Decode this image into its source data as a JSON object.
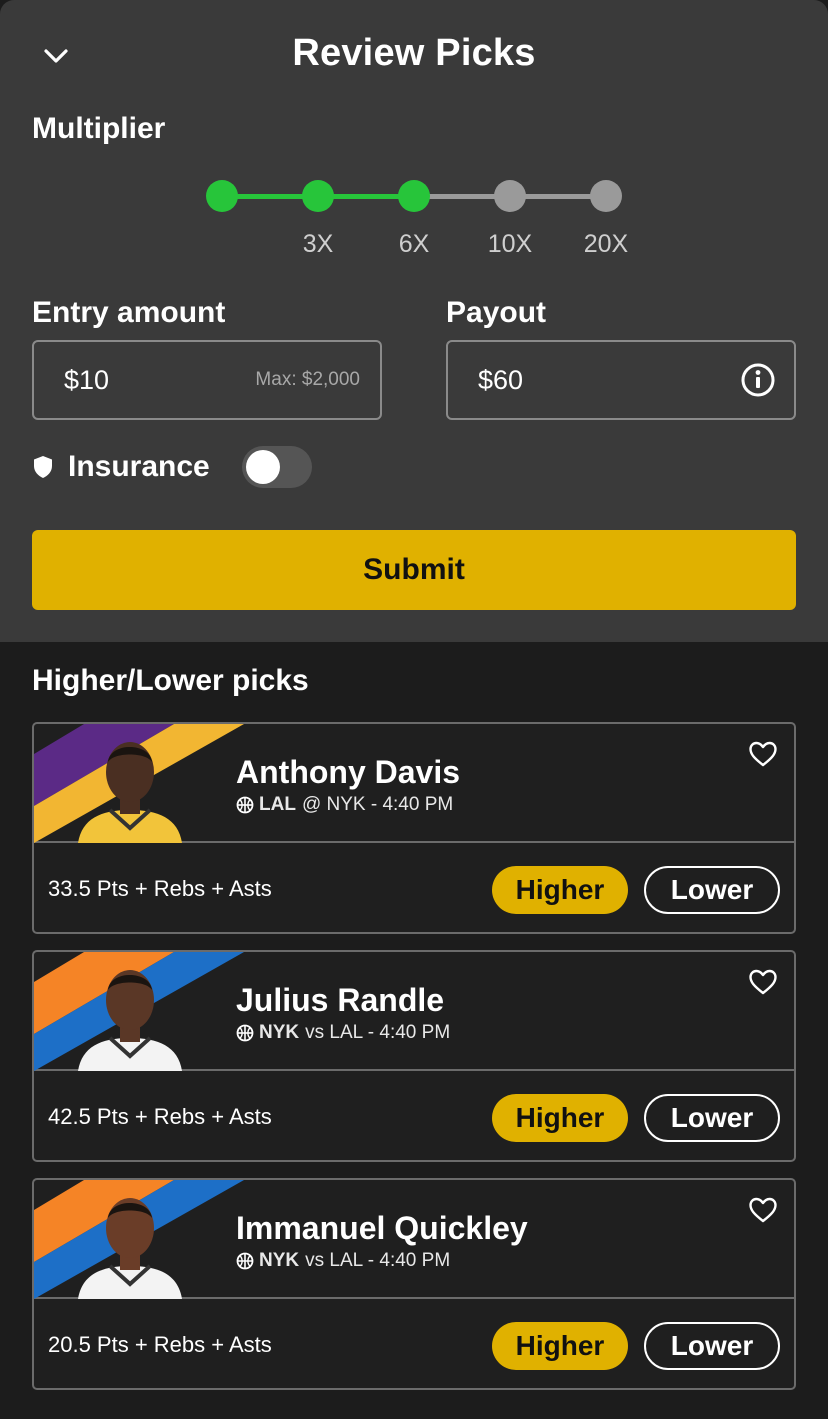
{
  "header": {
    "title": "Review Picks"
  },
  "multiplier": {
    "label": "Multiplier",
    "selected_step": 2,
    "active_color": "#27c53a",
    "inactive_color": "#9a9a9a",
    "steps": [
      "",
      "3X",
      "6X",
      "10X",
      "20X"
    ]
  },
  "entry": {
    "label": "Entry amount",
    "value": "$10",
    "hint": "Max: $2,000"
  },
  "payout": {
    "label": "Payout",
    "value": "$60"
  },
  "insurance": {
    "label": "Insurance",
    "enabled": false
  },
  "submit": {
    "label": "Submit",
    "color": "#e0b100"
  },
  "picks": {
    "heading": "Higher/Lower picks",
    "higher_color": "#e0b100",
    "items": [
      {
        "name": "Anthony Davis",
        "team": "LAL",
        "matchup": "@ NYK - 4:40 PM",
        "stat": "33.5 Pts + Rebs + Asts",
        "higher_label": "Higher",
        "lower_label": "Lower",
        "stripe_colors": [
          "#5b2a86",
          "#f2b632"
        ],
        "jersey_color": "#f2c43a",
        "skin_color": "#4a2f22"
      },
      {
        "name": "Julius Randle",
        "team": "NYK",
        "matchup": "vs LAL - 4:40 PM",
        "stat": "42.5 Pts + Rebs + Asts",
        "higher_label": "Higher",
        "lower_label": "Lower",
        "stripe_colors": [
          "#f58426",
          "#1d6fc7"
        ],
        "jersey_color": "#f3f3f3",
        "skin_color": "#5a3726"
      },
      {
        "name": "Immanuel Quickley",
        "team": "NYK",
        "matchup": "vs LAL - 4:40 PM",
        "stat": "20.5 Pts + Rebs + Asts",
        "higher_label": "Higher",
        "lower_label": "Lower",
        "stripe_colors": [
          "#f58426",
          "#1d6fc7"
        ],
        "jersey_color": "#f3f3f3",
        "skin_color": "#6a3d28"
      }
    ]
  }
}
